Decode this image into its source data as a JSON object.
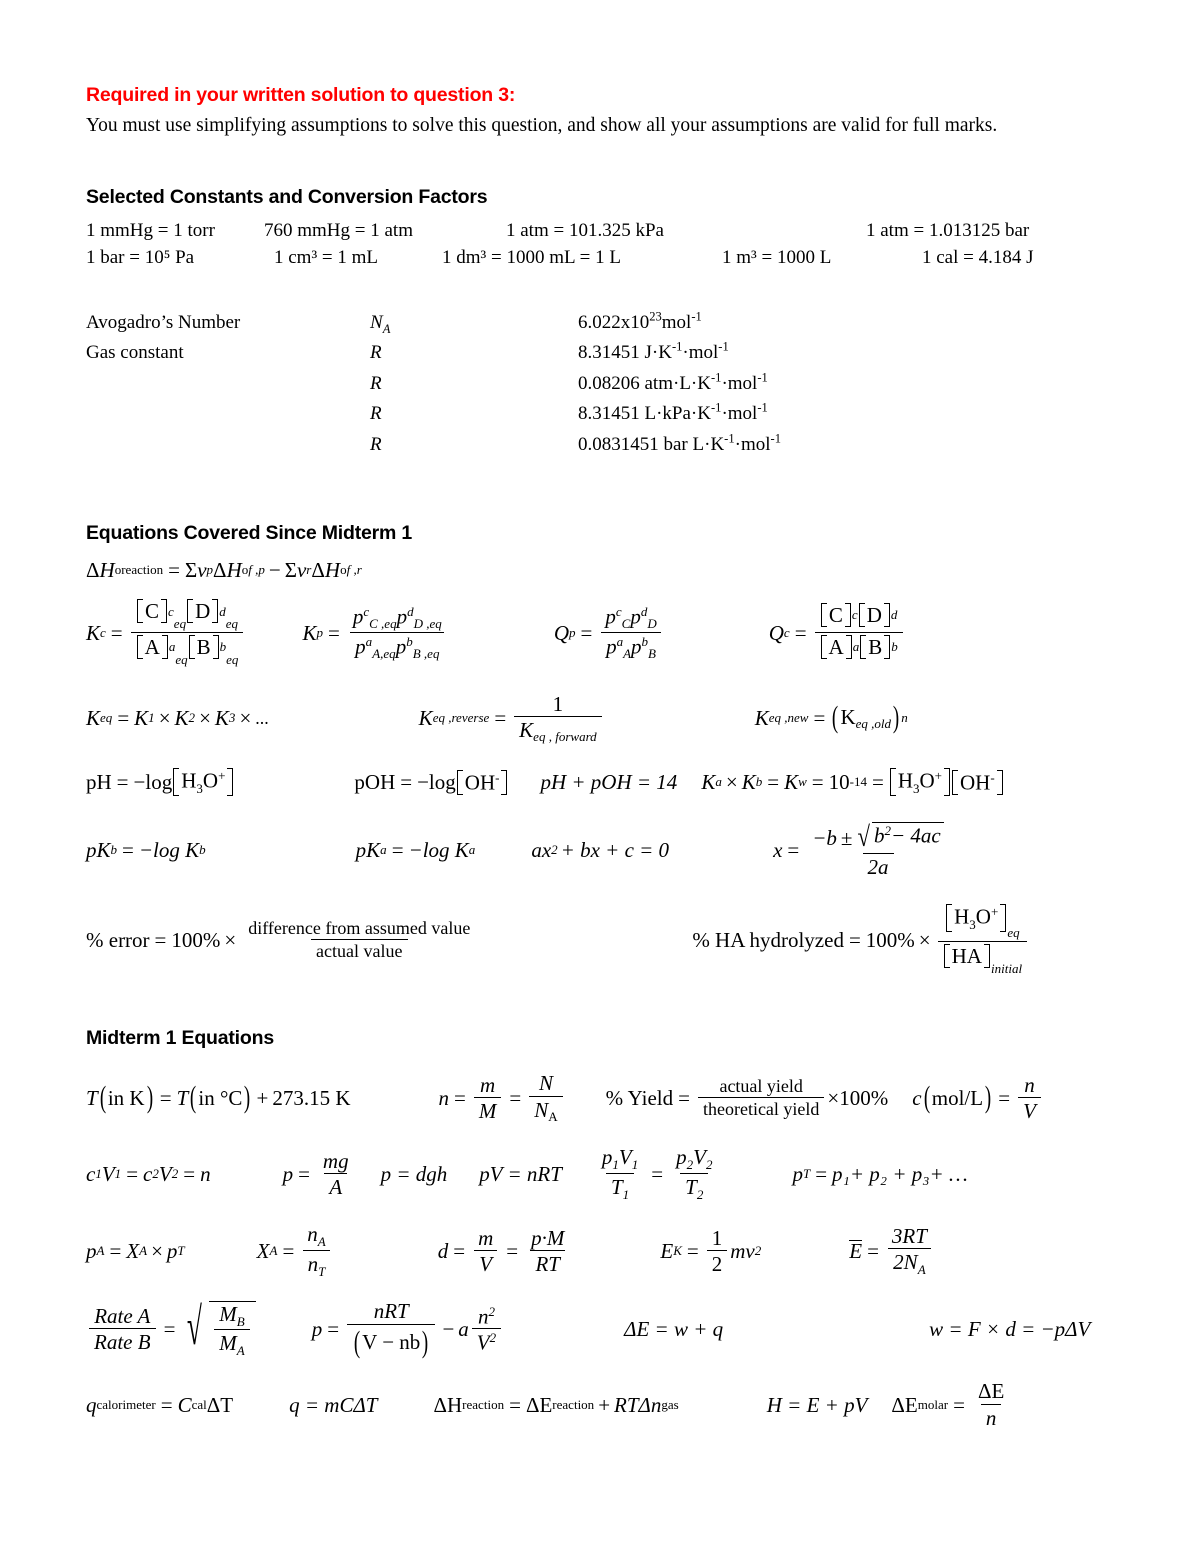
{
  "required_notice": {
    "title": "Required in your written solution to question 3:",
    "body": "You must use simplifying assumptions to solve this question, and show all your assumptions are valid for full marks."
  },
  "constants_section": {
    "heading": "Selected Constants and Conversion Factors",
    "conversions_row1": [
      "1 mmHg = 1 torr",
      "760 mmHg = 1 atm",
      "1 atm = 101.325 kPa",
      "1 atm = 1.013125 bar"
    ],
    "conversions_row2": [
      "1 bar = 10⁵ Pa",
      "1 cm³ = 1 mL",
      "1 dm³ = 1000 mL = 1 L",
      "1 m³ = 1000 L",
      "1 cal = 4.184 J"
    ],
    "table": [
      {
        "name": "Avogadro’s Number",
        "symbol": "N",
        "symbol_sub": "A",
        "value": "6.022x10",
        "value_exp": "23",
        "value_tail": "mol",
        "value_tail_exp": "-1"
      },
      {
        "name": "Gas constant",
        "symbol": "R",
        "symbol_sub": "",
        "value": "8.31451 J·K",
        "value_exp": "-1",
        "value_tail": "·mol",
        "value_tail_exp": "-1"
      },
      {
        "name": "",
        "symbol": "R",
        "symbol_sub": "",
        "value": "0.08206 atm·L·K",
        "value_exp": "-1",
        "value_tail": "·mol",
        "value_tail_exp": "-1"
      },
      {
        "name": "",
        "symbol": "R",
        "symbol_sub": "",
        "value": "8.31451 L·kPa·K",
        "value_exp": "-1",
        "value_tail": "·mol",
        "value_tail_exp": "-1"
      },
      {
        "name": "",
        "symbol": "R",
        "symbol_sub": "",
        "value": "0.0831451 bar L·K",
        "value_exp": "-1",
        "value_tail": "·mol",
        "value_tail_exp": "-1"
      }
    ]
  },
  "since_midterm": {
    "heading": "Equations Covered Since Midterm 1",
    "hess": {
      "lhs_delta": "Δ",
      "lhs_H": "H",
      "lhs_sup": "o",
      "lhs_sub": "reaction",
      "eq": "=",
      "sigma": "Σ",
      "nu": "ν",
      "sub_p": "p",
      "term1_sub": "f ,p",
      "minus": "−",
      "sub_r": "r",
      "term2_sub": "f ,r"
    },
    "kc": {
      "lhs": "K",
      "lhs_sub": "c",
      "num1": "C",
      "num1_exp": "c",
      "num1_sub": "eq",
      "num2": "D",
      "num2_exp": "d",
      "num2_sub": "eq",
      "den1": "A",
      "den1_exp": "a",
      "den1_sub": "eq",
      "den2": "B",
      "den2_exp": "b",
      "den2_sub": "eq"
    },
    "kp": {
      "lhs": "K",
      "lhs_sub": "p",
      "p": "p",
      "num1_exp": "c",
      "num1_sub": "C ,eq",
      "num2_exp": "d",
      "num2_sub": "D ,eq",
      "den1_exp": "a",
      "den1_sub": "A,eq",
      "den2_exp": "b",
      "den2_sub": "B ,eq"
    },
    "qp": {
      "lhs": "Q",
      "lhs_sub": "p",
      "p": "p",
      "num1_exp": "c",
      "num1_sub": "C",
      "num2_exp": "d",
      "num2_sub": "D",
      "den1_exp": "a",
      "den1_sub": "A",
      "den2_exp": "b",
      "den2_sub": "B"
    },
    "qc": {
      "lhs": "Q",
      "lhs_sub": "c",
      "num1": "C",
      "num1_exp": "c",
      "num2": "D",
      "num2_exp": "d",
      "den1": "A",
      "den1_exp": "a",
      "den2": "B",
      "den2_exp": "b"
    },
    "keq_multi": {
      "lhs": "K",
      "lhs_sub": "eq",
      "k": "K",
      "s1": "1",
      "s2": "2",
      "s3": "3",
      "times": "×",
      "ellipsis": "..."
    },
    "keq_reverse": {
      "lhs": "K",
      "lhs_sub": "eq ,reverse",
      "one": "1",
      "den": "K",
      "den_sub": "eq , forward"
    },
    "keq_new": {
      "lhs": "K",
      "lhs_sub": "eq ,new",
      "inner": "K",
      "inner_sub": "eq ,old",
      "exp": "n"
    },
    "ph": {
      "lhs": "pH",
      "rhs": "−log",
      "species": "H",
      "species_sub": "3",
      "species2": "O",
      "species_sup": "+"
    },
    "poh": {
      "lhs": "pOH",
      "rhs": "−log",
      "species": "OH",
      "species_sup": "-"
    },
    "ph_poh": {
      "text": "pH + pOH = 14"
    },
    "kw": {
      "ka": "K",
      "ka_sub": "a",
      "times": "×",
      "kb": "K",
      "kb_sub": "b",
      "kw": "K",
      "kw_sub": "w",
      "ten": "10",
      "ten_exp": "-14",
      "h3o": "H",
      "h3o_sub": "3",
      "h3o_o": "O",
      "h3o_sup": "+",
      "oh": "OH",
      "oh_sup": "-"
    },
    "pkb": {
      "lhs": "pK",
      "lhs_sub": "b",
      "rhs": "−log K",
      "rhs_sub": "b"
    },
    "pka": {
      "lhs": "pK",
      "lhs_sub": "a",
      "rhs": "−log K",
      "rhs_sub": "a"
    },
    "quadratic": {
      "text_a": "ax",
      "exp": "2",
      "text_b": "+ bx + c = 0"
    },
    "quad_formula": {
      "x": "x",
      "num_b": "−b",
      "pm": "±",
      "rad_b": "b",
      "rad_exp": "2",
      "rad_rest": "− 4ac",
      "den": "2a"
    },
    "percent_error": {
      "lhs": "% error",
      "eq": "=",
      "val": "100%",
      "times": "×",
      "num": "difference from assumed value",
      "den": "actual value"
    },
    "percent_hydrolyzed": {
      "lhs": "% HA hydrolyzed",
      "eq": "=",
      "val": "100%",
      "times": "×",
      "num": "H",
      "num_sub": "3",
      "num_o": "O",
      "num_sup": "+",
      "num_post_sub": "eq",
      "den": "HA",
      "den_post_sub": "initial"
    }
  },
  "midterm1": {
    "heading": "Midterm 1 Equations",
    "temp": {
      "t": "T",
      "in_k": "in K",
      "eq": "=",
      "t2": "T",
      "in_c": "in °C",
      "plus": "+",
      "value": "273.15 K"
    },
    "moles": {
      "n": "n",
      "eq": "=",
      "m": "m",
      "M": "M",
      "eq2": "=",
      "N": "N",
      "NA": "N",
      "NA_sub": "A"
    },
    "yield": {
      "lhs": "% Yield",
      "eq": "=",
      "num": "actual yield",
      "den": "theoretical yield",
      "times": "×100%"
    },
    "conc": {
      "c": "c",
      "unit": "mol/L",
      "eq": "=",
      "n": "n",
      "V": "V"
    },
    "dilution": {
      "text": "c",
      "s1": "1",
      "V": "V",
      "s2": "2",
      "n": "n"
    },
    "pressure_mg": {
      "p": "p",
      "eq": "=",
      "num": "mg",
      "den": "A"
    },
    "pressure_dgh": {
      "text": "p = dgh"
    },
    "ideal_gas": {
      "text": "pV = nRT"
    },
    "combined": {
      "p1": "p",
      "V1": "V",
      "s1": "1",
      "T1": "T",
      "p2": "p",
      "V2": "V",
      "s2": "2",
      "T2": "T"
    },
    "dalton": {
      "pt": "p",
      "pt_sub": "T",
      "eq": "=",
      "terms": "p₁+ p₂ + p₃+ …"
    },
    "partial": {
      "pa": "p",
      "pa_sub": "A",
      "eq": "=",
      "X": "X",
      "X_sub": "A",
      "times": "×",
      "pt": "p",
      "pt_sub": "T"
    },
    "mole_frac": {
      "X": "X",
      "X_sub": "A",
      "eq": "=",
      "num": "n",
      "num_sub": "A",
      "den": "n",
      "den_sub": "T"
    },
    "density": {
      "d": "d",
      "eq": "=",
      "m": "m",
      "V": "V",
      "eq2": "=",
      "num": "p·M",
      "den": "RT"
    },
    "kinetic": {
      "E": "E",
      "E_sub": "K",
      "eq": "=",
      "one": "1",
      "two": "2",
      "rest": "mv",
      "exp": "2"
    },
    "avg_energy": {
      "E": "E",
      "eq": "=",
      "num": "3RT",
      "den": "2N",
      "den_sub": "A"
    },
    "effusion": {
      "num": "Rate A",
      "den": "Rate B",
      "eq": "=",
      "rnum": "M",
      "rnum_sub": "B",
      "rden": "M",
      "rden_sub": "A"
    },
    "vdw": {
      "p": "p",
      "eq": "=",
      "num": "nRT",
      "den": "V − nb",
      "minus": "−",
      "a": "a",
      "n": "n",
      "n_exp": "2",
      "V": "V",
      "V_exp": "2"
    },
    "first_law": {
      "text": "ΔE = w + q"
    },
    "work": {
      "text": "w = F × d = −pΔV"
    },
    "calorimeter": {
      "q": "q",
      "q_sub": "calorimeter",
      "eq": "=",
      "C": "C",
      "C_sub": "cal",
      "dT": "ΔT"
    },
    "heat": {
      "text": "q = mCΔT"
    },
    "enthalpy_rxn": {
      "dH": "ΔH",
      "dH_sub": "reaction",
      "eq": "=",
      "dE": "ΔE",
      "dE_sub": "reaction",
      "plus": "+",
      "rest": "RTΔn",
      "rest_sub": "gas"
    },
    "enthalpy_def": {
      "text": "H = E + pV"
    },
    "molar_energy": {
      "dE": "ΔE",
      "dE_sub": "molar",
      "eq": "=",
      "num": "ΔE",
      "den": "n"
    }
  },
  "colors": {
    "accent_red": "#ff0000",
    "text": "#000000",
    "background": "#ffffff"
  }
}
